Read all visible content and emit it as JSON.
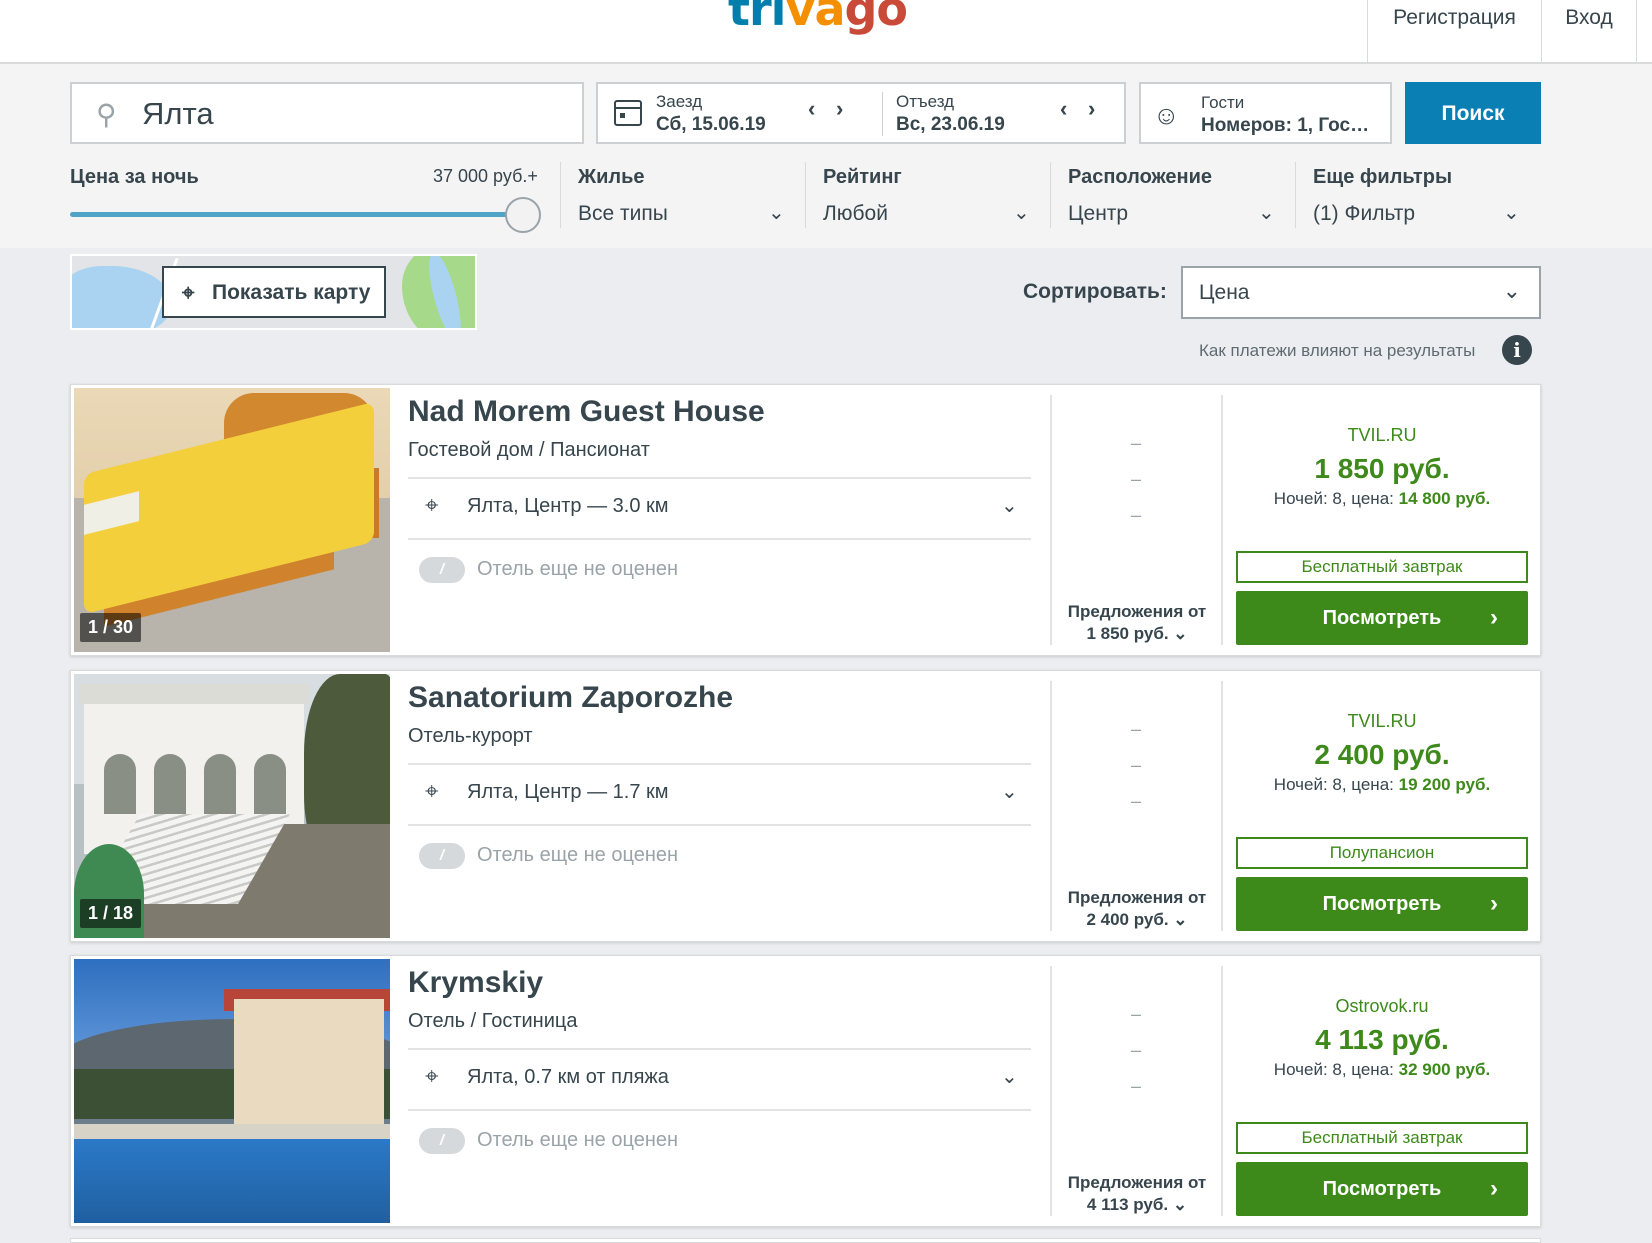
{
  "header": {
    "logo": {
      "part1": "tri",
      "part2": "va",
      "part3": "go"
    },
    "register": "Регистрация",
    "login": "Вход"
  },
  "search": {
    "destination": "Ялта",
    "checkin_label": "Заезд",
    "checkin_value": "Сб, 15.06.19",
    "checkout_label": "Отъезд",
    "checkout_value": "Вс, 23.06.19",
    "guests_label": "Гости",
    "guests_value": "Номеров: 1, Гос…",
    "button": "Поиск"
  },
  "filters": {
    "price_title": "Цена за ночь",
    "price_max": "37 000 руб.+",
    "price_level_fraction": 1.0,
    "housing_title": "Жилье",
    "housing_value": "Все типы",
    "rating_title": "Рейтинг",
    "rating_value": "Любой",
    "location_title": "Расположение",
    "location_value": "Центр",
    "more_title": "Еще фильтры",
    "more_value": "(1) Фильтр"
  },
  "map": {
    "button": "Показать карту"
  },
  "sort": {
    "label": "Сортировать:",
    "value": "Цена"
  },
  "payment_note": "Как платежи влияют на результаты",
  "hotels": [
    {
      "name": "Nad Morem Guest House",
      "type": "Гостевой дом / Пансионат",
      "location": "Ялта, Центр — 3.0 км",
      "rating": "Отель еще не оценен",
      "photo_counter": "1 / 30",
      "offers_label": "Предложения от",
      "offers_price": "1 850 руб.",
      "partner": "TVIL.RU",
      "price": "1 850 руб.",
      "nights_prefix": "Ночей: 8, цена:",
      "nights_total": "14 800 руб.",
      "badge": "Бесплатный завтрак",
      "view_button": "Посмотреть"
    },
    {
      "name": "Sanatorium Zaporozhe",
      "type": "Отель-курорт",
      "location": "Ялта, Центр — 1.7 км",
      "rating": "Отель еще не оценен",
      "photo_counter": "1 / 18",
      "offers_label": "Предложения от",
      "offers_price": "2 400 руб.",
      "partner": "TVIL.RU",
      "price": "2 400 руб.",
      "nights_prefix": "Ночей: 8, цена:",
      "nights_total": "19 200 руб.",
      "badge": "Полупансион",
      "view_button": "Посмотреть"
    },
    {
      "name": "Krymskiy",
      "type": "Отель / Гостиница",
      "location": "Ялта, 0.7 км от пляжа",
      "rating": "Отель еще не оценен",
      "photo_counter": "",
      "offers_label": "Предложения от",
      "offers_price": "4 113 руб.",
      "partner": "Ostrovok.ru",
      "price": "4 113 руб.",
      "nights_prefix": "Ночей: 8, цена:",
      "nights_total": "32 900 руб.",
      "badge": "Бесплатный завтрак",
      "view_button": "Посмотреть"
    }
  ],
  "icons": {
    "search": "search-icon",
    "calendar": "calendar-icon",
    "guests": "guests-icon",
    "pin": "map-pin-icon",
    "chevron": "chevron-down-icon",
    "info": "info-icon"
  },
  "colors": {
    "brand_blue": "#007fad",
    "brand_orange": "#f48f00",
    "brand_red": "#c94a38",
    "search_button": "#0a7fb3",
    "deal_green": "#3d8a1a"
  }
}
